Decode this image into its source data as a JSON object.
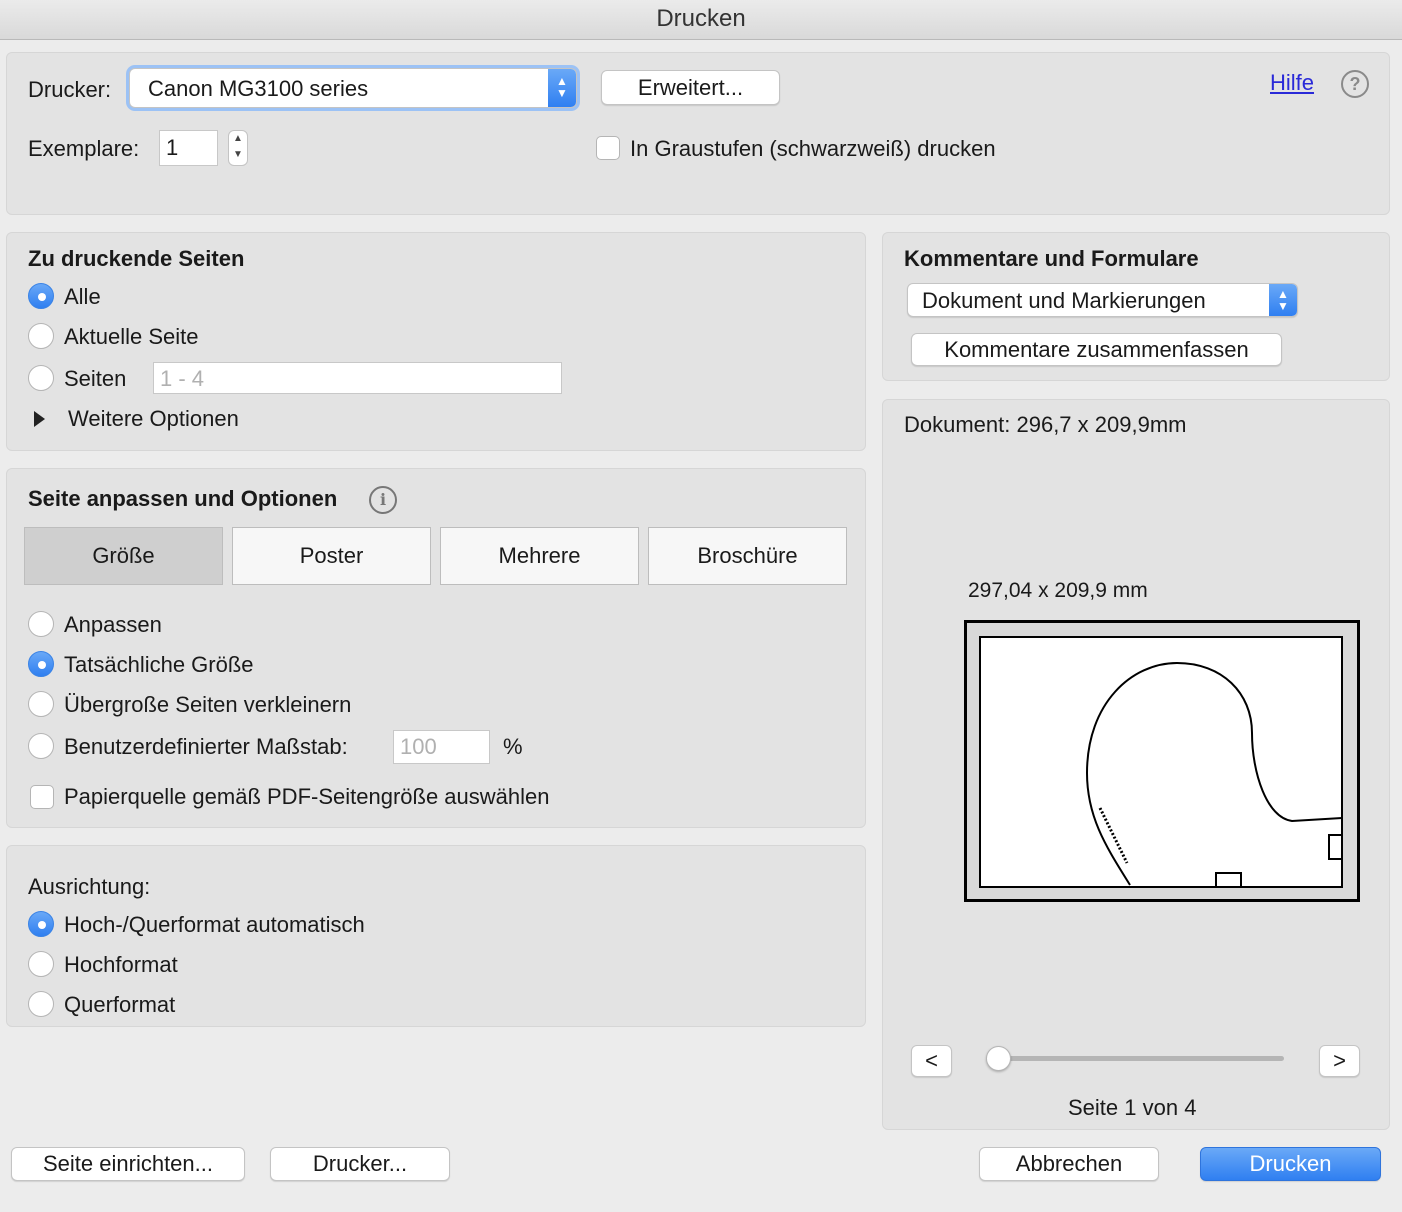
{
  "window": {
    "title": "Drucken"
  },
  "printer": {
    "label": "Drucker:",
    "selected": "Canon MG3100 series",
    "advanced_button": "Erweitert...",
    "help_link": "Hilfe",
    "help_icon": "question-circle-icon",
    "copies_label": "Exemplare:",
    "copies_value": "1",
    "grayscale_label": "In Graustufen (schwarzweiß) drucken",
    "grayscale_checked": false
  },
  "pages": {
    "heading": "Zu druckende Seiten",
    "options": [
      {
        "label": "Alle",
        "selected": true
      },
      {
        "label": "Aktuelle Seite",
        "selected": false
      },
      {
        "label": "Seiten",
        "selected": false
      }
    ],
    "range_placeholder": "1 - 4",
    "more_options": "Weitere Optionen"
  },
  "sizing": {
    "heading": "Seite anpassen und Optionen",
    "info_icon": "info-circle-icon",
    "tabs": [
      "Größe",
      "Poster",
      "Mehrere",
      "Broschüre"
    ],
    "active_tab": "Größe",
    "options": [
      {
        "label": "Anpassen",
        "selected": false
      },
      {
        "label": "Tatsächliche Größe",
        "selected": true
      },
      {
        "label": "Übergroße Seiten verkleinern",
        "selected": false
      },
      {
        "label": "Benutzerdefinierter Maßstab:",
        "selected": false
      }
    ],
    "scale_placeholder": "100",
    "scale_unit": "%",
    "paper_source_label": "Papierquelle gemäß PDF-Seitengröße auswählen",
    "paper_source_checked": false
  },
  "orientation": {
    "heading": "Ausrichtung:",
    "options": [
      {
        "label": "Hoch-/Querformat automatisch",
        "selected": true
      },
      {
        "label": "Hochformat",
        "selected": false
      },
      {
        "label": "Querformat",
        "selected": false
      }
    ]
  },
  "comments": {
    "heading": "Kommentare und Formulare",
    "selected": "Dokument und Markierungen",
    "summarize_button": "Kommentare zusammenfassen"
  },
  "preview": {
    "document_size": "Dokument: 296,7 x 209,9mm",
    "page_size": "297,04 x 209,9 mm",
    "prev_button": "<",
    "next_button": ">",
    "slider_position": 0,
    "page_indicator": "Seite 1 von 4"
  },
  "footer": {
    "page_setup_button": "Seite einrichten...",
    "printer_button": "Drucker...",
    "cancel_button": "Abbrechen",
    "print_button": "Drucken"
  },
  "colors": {
    "accent": "#2f7ff1",
    "panel": "#e3e3e3",
    "background": "#ececec"
  }
}
